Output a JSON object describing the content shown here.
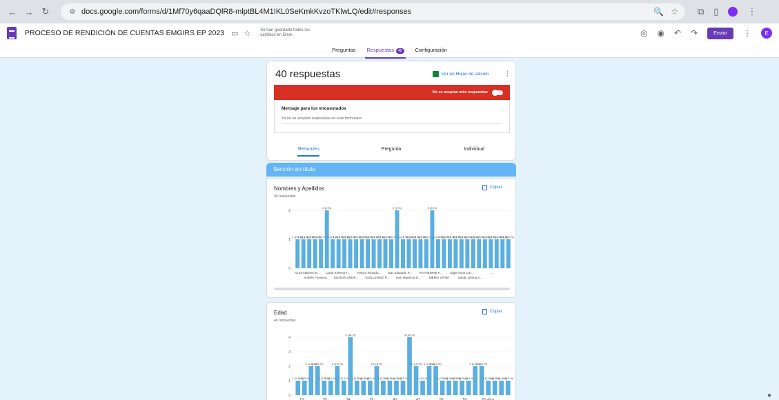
{
  "browser": {
    "url": "docs.google.com/forms/d/1Mf70y6qaaDQlR8-mlptBL4M1IKL0SeKmkKvzoTKlwLQ/edit#responses",
    "back_icon": "arrow-left-icon",
    "forward_icon": "arrow-right-icon",
    "reload_icon": "reload-icon",
    "profile_letter": ""
  },
  "header": {
    "title": "PROCESO DE RENDICIÓN DE CUENTAS EMGIRS EP 2023",
    "saved_status": "Se han guardado todos los cambios en Drive",
    "send_label": "Enviar",
    "avatar_letter": "E"
  },
  "tabs": [
    {
      "label": "Preguntas"
    },
    {
      "label": "Respuestas",
      "badge": "40"
    },
    {
      "label": "Configuración"
    }
  ],
  "summary": {
    "title": "40 respuestas",
    "sheets_label": "Ver en Hojas de cálculo",
    "banner_text": "No se aceptan más respuestas",
    "message_label": "Mensaje para los encuestados",
    "message_text": "Ya no se aceptan respuestas en este formulario",
    "subtabs": [
      "Resumen",
      "Pregunta",
      "Individual"
    ]
  },
  "section": {
    "title": "Sección sin título"
  },
  "questions": [
    {
      "title": "Nombres y Apellidos",
      "count": "40 respuestas",
      "copy_label": "Copiar"
    },
    {
      "title": "Edad",
      "count": "40 respuestas",
      "copy_label": "Copiar"
    }
  ],
  "chart_data": [
    {
      "type": "bar",
      "title": "Nombres y Apellidos",
      "ylim": [
        0,
        2
      ],
      "yticks": [
        0,
        1,
        2
      ],
      "bar_color": "#5aaee0",
      "values": [
        1,
        1,
        1,
        1,
        1,
        2,
        1,
        1,
        1,
        1,
        1,
        1,
        1,
        1,
        1,
        1,
        1,
        2,
        1,
        1,
        1,
        1,
        1,
        2,
        1,
        1,
        1,
        1,
        1,
        1,
        1,
        1,
        1,
        1,
        1,
        1,
        1
      ],
      "bar_labels_top": {
        "5": "2 (5 %)",
        "17": "2 (5 %)",
        "23": "2 (5 %)"
      },
      "x_labels_row1": [
        "ALEXANDRA B...",
        "Carla Ximena T...",
        "Franco Ricardo...",
        "Isac Eduardo P...",
        "KATHERINE F...",
        "Olga Ivone Car...",
        "..."
      ],
      "x_labels_row2": [
        "Andrés Fonseca",
        "EDISON ANDR...",
        "GUILLERMO P...",
        "Ivan Mauricio B...",
        "MERIV ORNA",
        "Sandy Janina A..."
      ]
    },
    {
      "type": "bar",
      "title": "Edad",
      "ylim": [
        0,
        4
      ],
      "yticks": [
        0,
        1,
        2,
        3,
        4
      ],
      "bar_color": "#5aaee0",
      "values": [
        1,
        1,
        2,
        2,
        1,
        1,
        2,
        1,
        4,
        1,
        1,
        1,
        2,
        1,
        1,
        1,
        1,
        4,
        2,
        1,
        2,
        2,
        1,
        1,
        1,
        1,
        1,
        2,
        2,
        1,
        1,
        1,
        1
      ],
      "bar_labels_top": {
        "8": "4 (10 %)",
        "17": "4 (10 %)"
      },
      "x_labels": [
        "19",
        "29",
        "34",
        "39",
        "43",
        "47",
        "56",
        "59",
        "65 años"
      ]
    }
  ]
}
